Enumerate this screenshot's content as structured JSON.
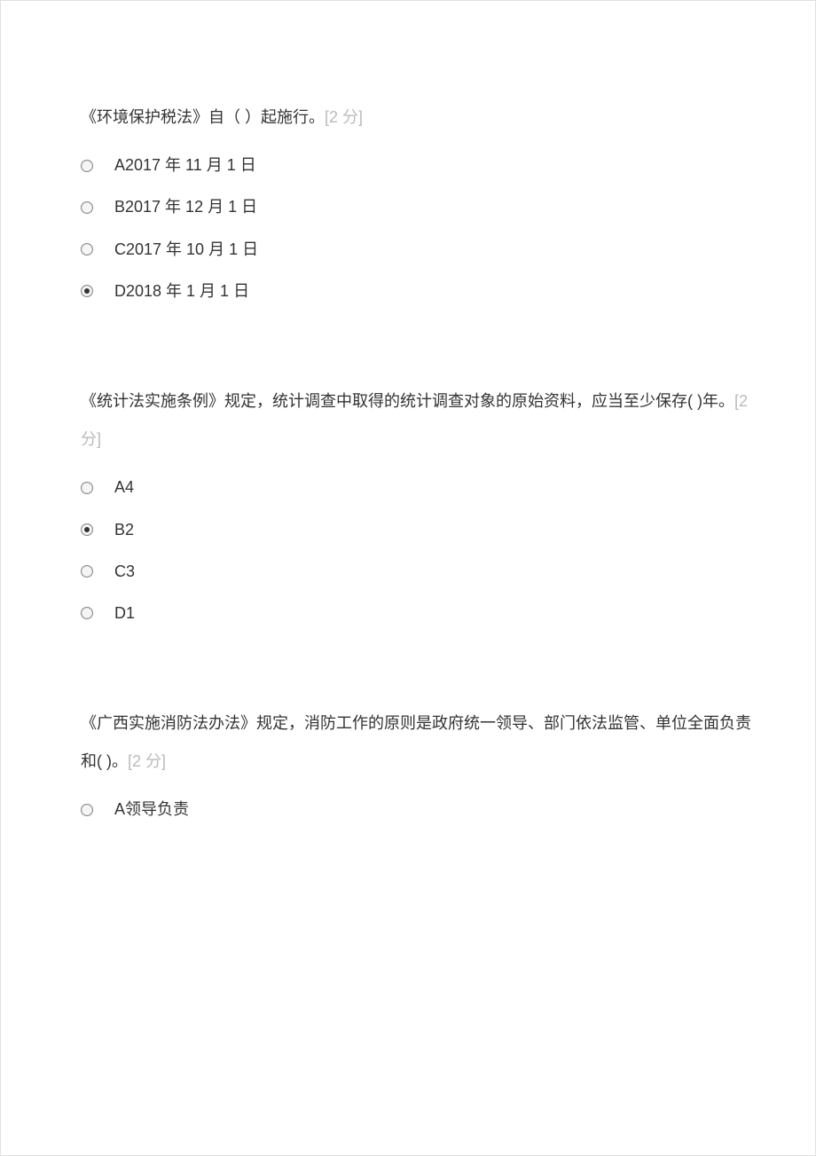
{
  "questions": [
    {
      "text": "《环境保护税法》自（   ）起施行。",
      "score": "[2 分]",
      "options": [
        {
          "letter": "A",
          "text": "2017 年 11 月 1 日",
          "selected": false
        },
        {
          "letter": "B",
          "text": "2017 年 12 月 1 日",
          "selected": false
        },
        {
          "letter": "C",
          "text": "2017 年 10 月 1 日",
          "selected": false
        },
        {
          "letter": "D",
          "text": "2018 年 1 月 1 日",
          "selected": true
        }
      ]
    },
    {
      "text": "《统计法实施条例》规定，统计调查中取得的统计调查对象的原始资料，应当至少保存( )年。",
      "score": "[2 分]",
      "options": [
        {
          "letter": "A",
          "text": "4",
          "selected": false
        },
        {
          "letter": "B",
          "text": "2",
          "selected": true
        },
        {
          "letter": "C",
          "text": "3",
          "selected": false
        },
        {
          "letter": "D",
          "text": "1",
          "selected": false
        }
      ]
    },
    {
      "text": "《广西实施消防法办法》规定，消防工作的原则是政府统一领导、部门依法监管、单位全面负责和( )。",
      "score": "[2 分]",
      "options": [
        {
          "letter": "A",
          "text": " 领导负责",
          "selected": false
        }
      ]
    }
  ]
}
